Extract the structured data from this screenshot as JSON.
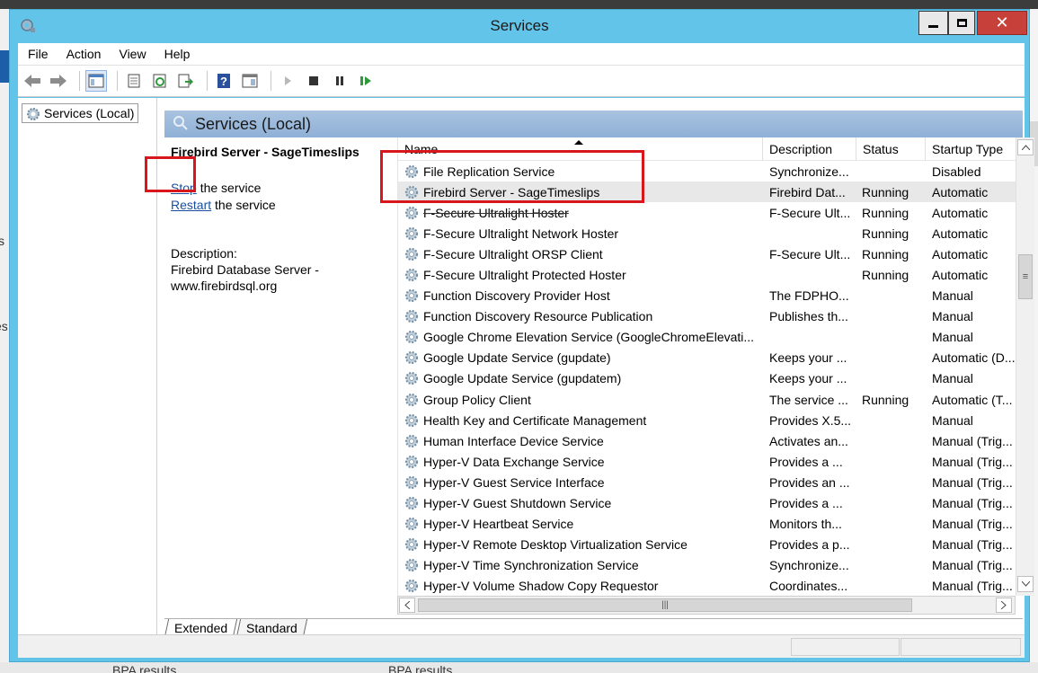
{
  "window": {
    "title": "Services",
    "controls": {
      "minimize": "minimize",
      "maximize": "maximize",
      "close": "close"
    }
  },
  "background": {
    "left_fragments": [
      "s",
      "es"
    ],
    "bottom_fragments": [
      "BPA results",
      "BPA results"
    ]
  },
  "menu": [
    "File",
    "Action",
    "View",
    "Help"
  ],
  "toolbar": {
    "icons": [
      "back-icon",
      "forward-icon",
      "console-tree-icon",
      "properties-icon",
      "refresh-icon",
      "export-list-icon",
      "help-icon",
      "show-action-pane-icon",
      "start-service-icon",
      "stop-service-icon",
      "pause-service-icon",
      "restart-service-icon"
    ]
  },
  "tree": {
    "root_label": "Services (Local)"
  },
  "pane": {
    "title": "Services (Local)",
    "selected_service": "Firebird Server - SageTimeslips",
    "stop_link": "Stop",
    "stop_suffix": " the service",
    "restart_link": "Restart",
    "restart_suffix": " the service",
    "description_label": "Description:",
    "description_text": "Firebird Database Server - www.firebirdsql.org"
  },
  "columns": {
    "name": "Name",
    "description": "Description",
    "status": "Status",
    "startup_type": "Startup Type"
  },
  "services": [
    {
      "name": "File Replication Service",
      "description": "Synchronize...",
      "status": "",
      "startup": "Disabled"
    },
    {
      "name": "Firebird Server - SageTimeslips",
      "description": "Firebird Dat...",
      "status": "Running",
      "startup": "Automatic"
    },
    {
      "name": "F-Secure Ultralight Hoster",
      "description": "F-Secure Ult...",
      "status": "Running",
      "startup": "Automatic"
    },
    {
      "name": "F-Secure Ultralight Network Hoster",
      "description": "",
      "status": "Running",
      "startup": "Automatic"
    },
    {
      "name": "F-Secure Ultralight ORSP Client",
      "description": "F-Secure Ult...",
      "status": "Running",
      "startup": "Automatic"
    },
    {
      "name": "F-Secure Ultralight Protected Hoster",
      "description": "",
      "status": "Running",
      "startup": "Automatic"
    },
    {
      "name": "Function Discovery Provider Host",
      "description": "The FDPHO...",
      "status": "",
      "startup": "Manual"
    },
    {
      "name": "Function Discovery Resource Publication",
      "description": "Publishes th...",
      "status": "",
      "startup": "Manual"
    },
    {
      "name": "Google Chrome Elevation Service (GoogleChromeElevati...",
      "description": "",
      "status": "",
      "startup": "Manual"
    },
    {
      "name": "Google Update Service (gupdate)",
      "description": "Keeps your ...",
      "status": "",
      "startup": "Automatic (D..."
    },
    {
      "name": "Google Update Service (gupdatem)",
      "description": "Keeps your ...",
      "status": "",
      "startup": "Manual"
    },
    {
      "name": "Group Policy Client",
      "description": "The service ...",
      "status": "Running",
      "startup": "Automatic (T..."
    },
    {
      "name": "Health Key and Certificate Management",
      "description": "Provides X.5...",
      "status": "",
      "startup": "Manual"
    },
    {
      "name": "Human Interface Device Service",
      "description": "Activates an...",
      "status": "",
      "startup": "Manual (Trig..."
    },
    {
      "name": "Hyper-V Data Exchange Service",
      "description": "Provides a ...",
      "status": "",
      "startup": "Manual (Trig..."
    },
    {
      "name": "Hyper-V Guest Service Interface",
      "description": "Provides an ...",
      "status": "",
      "startup": "Manual (Trig..."
    },
    {
      "name": "Hyper-V Guest Shutdown Service",
      "description": "Provides a ...",
      "status": "",
      "startup": "Manual (Trig..."
    },
    {
      "name": "Hyper-V Heartbeat Service",
      "description": "Monitors th...",
      "status": "",
      "startup": "Manual (Trig..."
    },
    {
      "name": "Hyper-V Remote Desktop Virtualization Service",
      "description": "Provides a p...",
      "status": "",
      "startup": "Manual (Trig..."
    },
    {
      "name": "Hyper-V Time Synchronization Service",
      "description": "Synchronize...",
      "status": "",
      "startup": "Manual (Trig..."
    },
    {
      "name": "Hyper-V Volume Shadow Copy Requestor",
      "description": "Coordinates...",
      "status": "",
      "startup": "Manual (Trig..."
    }
  ],
  "tabs": [
    "Extended",
    "Standard"
  ],
  "colors": {
    "title_bar": "#62c4e8",
    "close_button": "#c7413a",
    "highlight": "#d9161c",
    "pane_header": "#a9c3e0",
    "link": "#1a4fa0"
  }
}
